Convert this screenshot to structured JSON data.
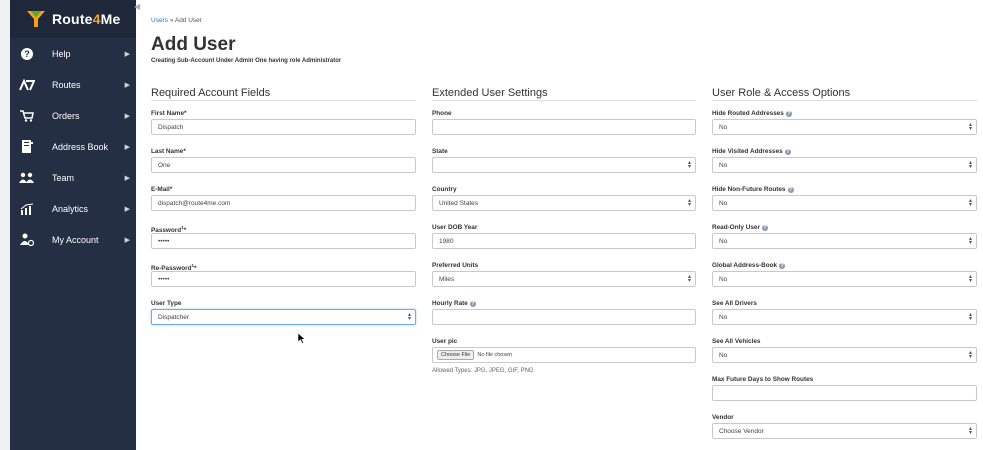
{
  "brand": {
    "name_a": "Route",
    "name_b": "4",
    "name_c": "Me",
    "accent": "#f0a31c"
  },
  "sidebar": {
    "items": [
      {
        "label": "Help",
        "icon": "help-icon"
      },
      {
        "label": "Routes",
        "icon": "routes-icon"
      },
      {
        "label": "Orders",
        "icon": "cart-icon"
      },
      {
        "label": "Address Book",
        "icon": "address-book-icon"
      },
      {
        "label": "Team",
        "icon": "team-icon"
      },
      {
        "label": "Analytics",
        "icon": "analytics-icon"
      },
      {
        "label": "My Account",
        "icon": "account-icon"
      }
    ]
  },
  "breadcrumb": {
    "link": "Users",
    "separator": " » ",
    "current": "Add User"
  },
  "page": {
    "title": "Add User",
    "subtitle": "Creating Sub-Account Under Admin One having role Administrator"
  },
  "required": {
    "title": "Required Account Fields",
    "first_name": {
      "label": "First Name*",
      "value": "Dispatch"
    },
    "last_name": {
      "label": "Last Name*",
      "value": "One"
    },
    "email": {
      "label": "E-Mail*",
      "value": "dispatch@route4me.com"
    },
    "password": {
      "label": "Password",
      "sup": "1",
      "star": "*",
      "value": "•••••"
    },
    "repassword": {
      "label": "Re-Password",
      "sup": "1",
      "star": "*",
      "value": "•••••"
    },
    "user_type": {
      "label": "User Type",
      "value": "Dispatcher"
    }
  },
  "extended": {
    "title": "Extended User Settings",
    "phone": {
      "label": "Phone",
      "value": ""
    },
    "state": {
      "label": "State",
      "value": ""
    },
    "country": {
      "label": "Country",
      "value": "United States"
    },
    "dob": {
      "label": "User DOB Year",
      "value": "1980"
    },
    "units": {
      "label": "Preferred Units",
      "value": "Miles"
    },
    "hourly": {
      "label": "Hourly Rate",
      "value": ""
    },
    "userpic": {
      "label": "User pic",
      "button": "Choose File",
      "status": "No file chosen",
      "help": "Allowed Types: JPG, JPEG, GIF, PNG"
    }
  },
  "roles": {
    "title": "User Role & Access Options",
    "hide_routed": {
      "label": "Hide Routed Addresses",
      "value": "No"
    },
    "hide_visited": {
      "label": "Hide Visited Addresses",
      "value": "No"
    },
    "hide_nonfuture": {
      "label": "Hide Non-Future Routes",
      "value": "No"
    },
    "readonly": {
      "label": "Read-Only User",
      "value": "No"
    },
    "global_ab": {
      "label": "Global Address-Book",
      "value": "No"
    },
    "see_drivers": {
      "label": "See All Drivers",
      "value": "No"
    },
    "see_vehicles": {
      "label": "See All Vehicles",
      "value": "No"
    },
    "max_future": {
      "label": "Max Future Days to Show Routes",
      "value": ""
    },
    "vendor": {
      "label": "Vendor",
      "value": "Choose Vendor"
    }
  },
  "icons": {
    "help_badge": "question-icon",
    "select_arrow": "up-down-arrow-icon"
  }
}
